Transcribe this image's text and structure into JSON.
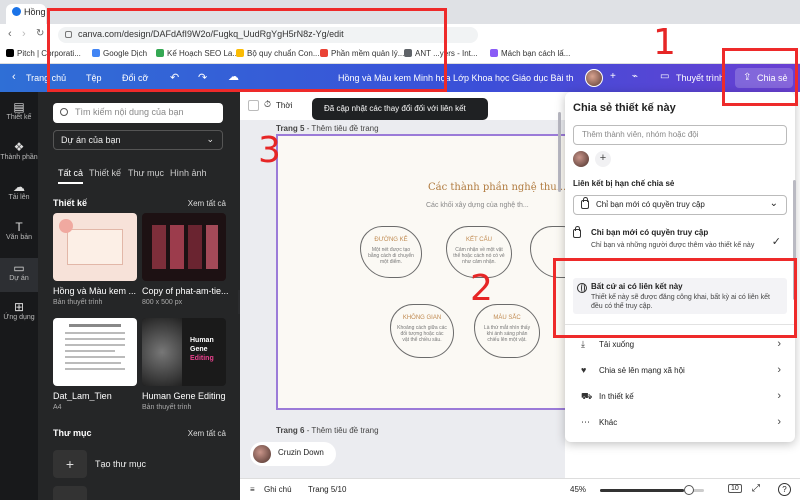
{
  "browser": {
    "tab_title": "Hồng v",
    "url": "canva.com/design/DAFdAfI9W2o/Fugkq_UudRgYgH5rN8z-Yg/edit",
    "bookmarks": [
      {
        "label": "Pitch | Corporati...",
        "color": "#000000"
      },
      {
        "label": "Google Dịch",
        "color": "#4285f4"
      },
      {
        "label": "Kế Hoạch SEO La...",
        "color": "#34a853"
      },
      {
        "label": "Bộ quy chuẩn Con...",
        "color": "#fbbc04"
      },
      {
        "label": "Phần mềm quản lý...",
        "color": "#ea4335"
      },
      {
        "label": "ANT ...yers - Int...",
        "color": "#5f6368"
      },
      {
        "label": "Mách bạn cách lấ...",
        "color": "#8a5cf6"
      }
    ]
  },
  "toolbar": {
    "back_label": "Trang chủ",
    "file_label": "Tệp",
    "resize_label": "Đổi cỡ",
    "doc_title": "Hồng và Màu kem Minh họa Lớp Khoa học Giáo dục Bài thu...",
    "present_label": "Thuyết trình",
    "share_label": "Chia sẻ"
  },
  "rail": {
    "items": [
      {
        "label": "Thiết kế",
        "icon": "layout-icon"
      },
      {
        "label": "Thành phần",
        "icon": "shapes-icon"
      },
      {
        "label": "Tải lên",
        "icon": "cloud-upload-icon"
      },
      {
        "label": "Văn bản",
        "icon": "text-icon"
      },
      {
        "label": "Dự án",
        "icon": "folder-icon"
      },
      {
        "label": "Ứng dụng",
        "icon": "apps-icon"
      }
    ]
  },
  "panel": {
    "search_placeholder": "Tìm kiếm nội dung của bạn",
    "project_select": "Dự án của bạn",
    "tabs": [
      "Tất cả",
      "Thiết kế",
      "Thư mục",
      "Hình ảnh"
    ],
    "designs_heading": "Thiết kế",
    "see_all": "Xem tất cả",
    "designs": [
      {
        "name": "Hồng và Màu kem ...",
        "sub": "Bản thuyết trình"
      },
      {
        "name": "Copy of phat-am-tie...",
        "sub": "800 x 500 px"
      },
      {
        "name": "Dat_Lam_Tien",
        "sub": "A4"
      },
      {
        "name": "Human Gene Editing",
        "sub": "Bản thuyết trình"
      }
    ],
    "thumb_text_gene_1": "Human",
    "thumb_text_gene_2": "Gene",
    "thumb_text_gene_3": "Editing",
    "folders_heading": "Thư mục",
    "folders_see_all": "Xem tất cả",
    "create_folder": "Tạo thư mục"
  },
  "canvas": {
    "timer_label": "Thời",
    "toast": "Đã cập nhật các thay đổi đối với liên kết",
    "page5_label": "Trang 5",
    "page5_hint": "- Thêm tiêu đề trang",
    "slide_title": "Các thành phần nghệ thu...",
    "slide_subtitle": "Các khối xây dựng của nghệ th...",
    "blobs": [
      {
        "title": "ĐƯỜNG KẺ",
        "desc": "Một nét được tạo bằng cách di chuyển một điểm."
      },
      {
        "title": "KẾT CẤU",
        "desc": "Cảm nhận về một vật thể hoặc cách nó có vẻ như cảm nhận."
      },
      {
        "title": "KHÔNG GIAN",
        "desc": "Khoảng cách giữa các đối tượng hoặc các vật thể chiều sâu."
      },
      {
        "title": "MÀU SẮC",
        "desc": "Là thứ mắt nhìn thấy khi ánh sáng phản chiếu lên một vật."
      }
    ],
    "page6_label": "Trang 6",
    "page6_hint": "- Thêm tiêu đề trang",
    "presence_name": "Cruzin Down"
  },
  "bottom": {
    "notes_label": "Ghi chú",
    "page_counter": "Trang 5/10",
    "zoom": "45%",
    "zoom_level": 0.45,
    "pages_badge": "10",
    "help_label": "?"
  },
  "share_popover": {
    "title": "Chia sẻ thiết kế này",
    "people_placeholder": "Thêm thành viên, nhóm hoặc đội",
    "link_section_label": "Liên kết bị hạn chế chia sẻ",
    "access_select": "Chỉ bạn mới có quyền truy cập",
    "option_restricted_title": "Chỉ bạn mới có quyền truy cập",
    "option_restricted_desc": "Chỉ bạn và những người được thêm vào thiết kế này",
    "option_anyone_title": "Bất cứ ai có liên kết này",
    "option_anyone_desc": "Thiết kế này sẽ được đăng công khai, bất kỳ ai có liên kết đều có thể truy cập.",
    "actions": [
      {
        "label": "Tải xuống",
        "icon": "download-icon"
      },
      {
        "label": "Chia sẻ lên mạng xã hội",
        "icon": "heart-icon"
      },
      {
        "label": "In thiết kế",
        "icon": "truck-icon"
      },
      {
        "label": "Khác",
        "icon": "more-icon"
      }
    ]
  },
  "annotations": {
    "n1": "1",
    "n2": "2",
    "n3": "3",
    "color": "#ee2a2a"
  }
}
